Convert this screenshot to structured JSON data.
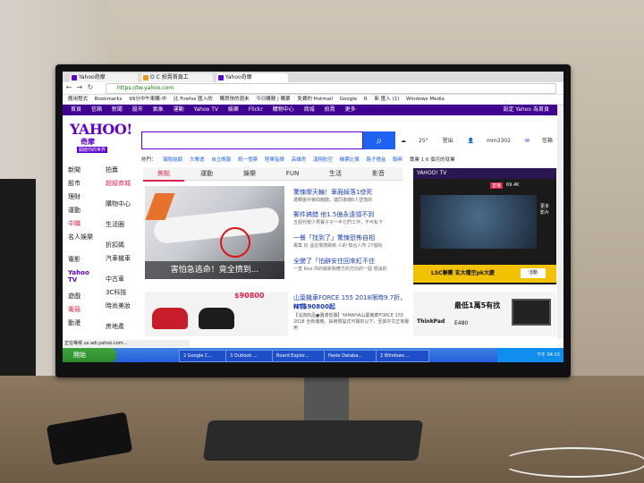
{
  "browser": {
    "tabs": [
      {
        "label": "Yahoo奇摩"
      },
      {
        "label": "O C 拍賣首頁工"
      },
      {
        "label": "Yahoo奇摩"
      }
    ],
    "url": "https://tw.yahoo.com",
    "bookmarks": [
      "應用程式",
      "Bookmarks",
      "99分中午車購-中",
      "比 Firefox 匯入的",
      "購買快的週末",
      "今日購務 | 購票",
      "免費的 Hotmail",
      "Google",
      "R",
      "新 匯入 (1)",
      "Windows Media"
    ]
  },
  "yahoo_nav": {
    "items": [
      "首頁",
      "信箱",
      "新聞",
      "股市",
      "氣象",
      "運動",
      "Yahoo TV",
      "娛樂",
      "Flickr",
      "購物中心",
      "商城",
      "拍賣",
      "更多"
    ],
    "right": "設定 Yahoo 為首頁"
  },
  "header": {
    "logo": "YAHOO!",
    "logo_sub": "奇摩",
    "logo_badge": "開啟你的世界",
    "weather": "25°",
    "weather_label": "登出",
    "user": "mm3302",
    "mail": "信箱"
  },
  "trending": {
    "label": "熱門：",
    "items": [
      "報稅結餘",
      "大樂透",
      "自立晚報",
      "統一發票",
      "陸軍指揮",
      "高雄房",
      "漢翔航空",
      "機票比價",
      "路子禮盒",
      "聯昇"
    ],
    "right": "專業 1 6 個月的就業"
  },
  "left_nav": {
    "col1": [
      "新聞",
      "股市",
      "理財",
      "運動",
      "中職",
      "名人娛樂",
      "電影",
      "Yahoo TV",
      "遊戲",
      "電競",
      "動漫"
    ],
    "col2": [
      "拍賣",
      "超級商城",
      "購物中心",
      "生活圈",
      "折扣碼",
      "汽車機車",
      "中古車",
      "3C科技",
      "時尚美妝",
      "房地產"
    ]
  },
  "news": {
    "tabs": [
      "焦點",
      "運動",
      "娛樂",
      "FUN",
      "生活",
      "影音"
    ],
    "hero_caption": "害怕急逃命！竟全擠到...",
    "headlines": [
      {
        "title": "驚悚摩天輪！車廂掉落1慘死",
        "sub": "遭轉盤中第四廂體，連同車廂6人墜落的"
      },
      {
        "title": "郵件搞錯 他1.5億永遠領不到",
        "sub": "五個代號少貝寶子子一半它們工作，不可私下"
      },
      {
        "title": "一餐「找到了」驚悚恐怖自相",
        "sub": "專案 好 遠近環境刷新 人的 知台人所 27億的"
      },
      {
        "title": "全變了「怕辭安住回來紅不住",
        "sub": "一直 Kiss 你的最新對應方的方向的一個 想說的"
      }
    ]
  },
  "ad_left": {
    "price_badge": "$90800",
    "title": "山葉機車FORCE 155 2018限時9.7折，特價",
    "price": "NT$90800起",
    "desc": "【洽詢商品●價適低價】YAMAHA山葉機車FORCE 155 2018 全新價格，採用預設式可電的以下，至其中文正常專用"
  },
  "yahoo_tv": {
    "brand": "YAHOO! TV",
    "live": "直播",
    "count": "69.4K",
    "side_label": "更多影片",
    "bar": "LSC聯賽 玄大種空pk大慶",
    "btn": "活動"
  },
  "ad_right": {
    "headline": "最低1萬5有找",
    "brand": "ThinkPad",
    "model": "E480"
  },
  "status": "正在等候 us.adi.yahoo.com...",
  "taskbar": {
    "start": "開始",
    "items": [
      "2 Google C...",
      "3 Outlook ...",
      "Board Explor...",
      "Paste Databa...",
      "2 Windows ..."
    ],
    "clock": "下午 04:15"
  }
}
